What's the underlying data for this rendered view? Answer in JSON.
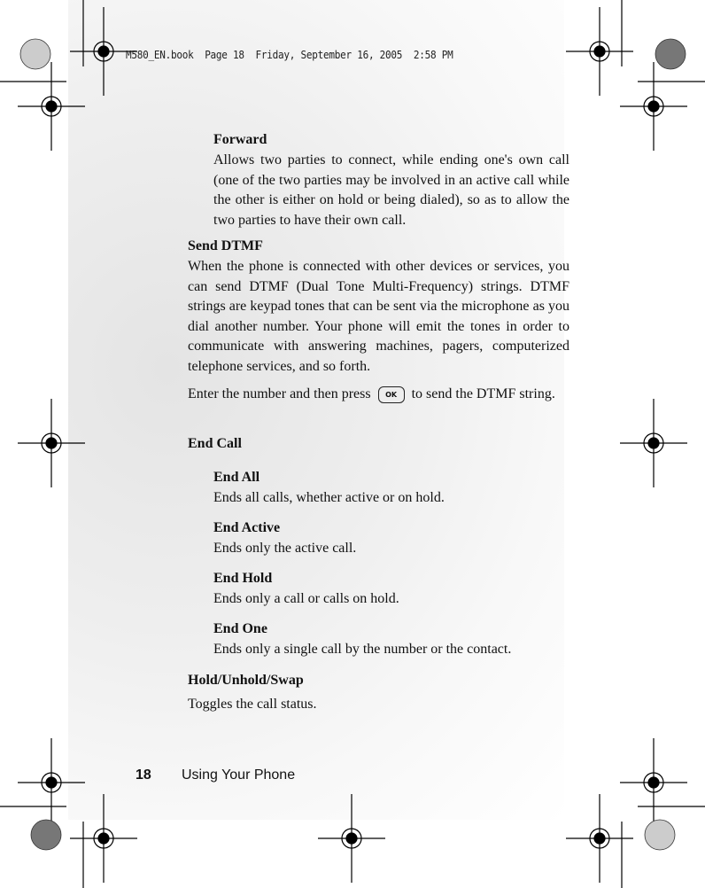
{
  "slug": "M580_EN.book  Page 18  Friday, September 16, 2005  2:58 PM",
  "forward": {
    "heading": "Forward",
    "text": "Allows two parties to connect, while ending one's own call (one of the two parties may be involved in an active call while the other is either on hold or being dialed), so as to allow the two parties to have their own call."
  },
  "send_dtmf": {
    "heading": "Send DTMF",
    "text": "When the phone is connected with other devices or services, you can send DTMF (Dual Tone Multi-Frequency) strings. DTMF strings are keypad tones that can be sent via the microphone as you dial another number. Your phone will emit the tones in order to communicate with answering machines, pagers, computerized telephone services, and so forth.",
    "enter_before": "Enter the number and then press",
    "ok_key": "OK",
    "enter_after": "to send the DTMF string."
  },
  "end_call": {
    "heading": "End Call",
    "items": [
      {
        "heading": "End All",
        "text": "Ends all calls, whether active or on hold."
      },
      {
        "heading": "End Active",
        "text": "Ends only the active call."
      },
      {
        "heading": "End Hold",
        "text": "Ends only a call or calls on hold."
      },
      {
        "heading": "End One",
        "text": "Ends only a single call by the number or the contact."
      }
    ]
  },
  "hold": {
    "heading": "Hold/Unhold/Swap",
    "text": "Toggles the call status."
  },
  "footer": {
    "page_number": "18",
    "section": "Using Your Phone"
  }
}
